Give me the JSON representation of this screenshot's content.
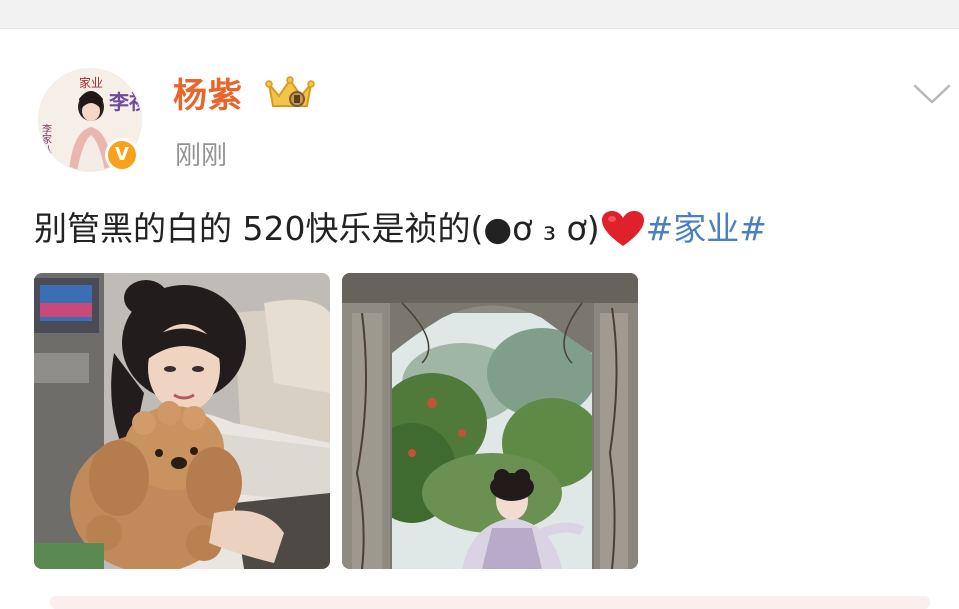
{
  "post": {
    "author_name": "杨紫",
    "timestamp": "刚刚",
    "text_main": "别管黑的白的 520快乐是祯的(●ơ ₃ ơ)",
    "topic": "#家业#",
    "verified_mark": "V"
  },
  "avatar": {
    "title_text": "家业",
    "name_text": "李祯",
    "side_text": "李家八房"
  },
  "icons": {
    "crown": "crown-badge-icon",
    "verified": "verified-badge-icon",
    "chevron": "chevron-down-icon",
    "heart": "heart-emoji-icon"
  },
  "colors": {
    "username": "#e8652c",
    "topic": "#4a7fc1",
    "text": "#222222",
    "timestamp": "#939393",
    "verified": "#f7a21b",
    "heart": "#e0202b"
  },
  "photos": [
    {
      "subject": "woman hugging brown poodle"
    },
    {
      "subject": "woman in costume under stone arch"
    }
  ]
}
